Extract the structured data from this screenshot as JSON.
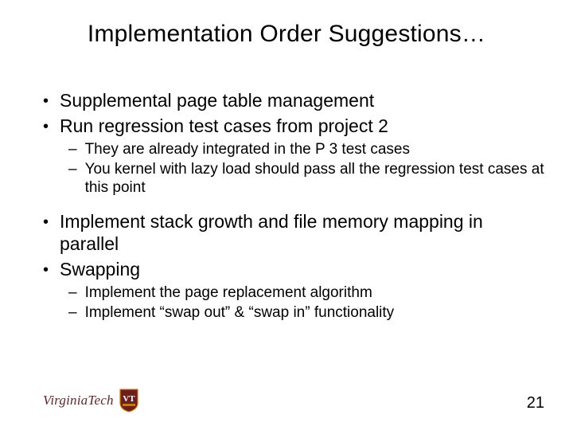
{
  "title": "Implementation Order Suggestions…",
  "bullets": {
    "b0": "Supplemental page table management",
    "b1": "Run regression test cases from project 2",
    "b1s0": "They are already integrated in the P 3 test cases",
    "b1s1": "You kernel with lazy load should pass all the regression test cases at this point",
    "b2": "Implement stack growth and file memory mapping in parallel",
    "b3": "Swapping",
    "b3s0": "Implement the page replacement algorithm",
    "b3s1": "Implement “swap out” & “swap in” functionality"
  },
  "footer": {
    "page": "21",
    "logo_text": "VirginiaTech"
  }
}
